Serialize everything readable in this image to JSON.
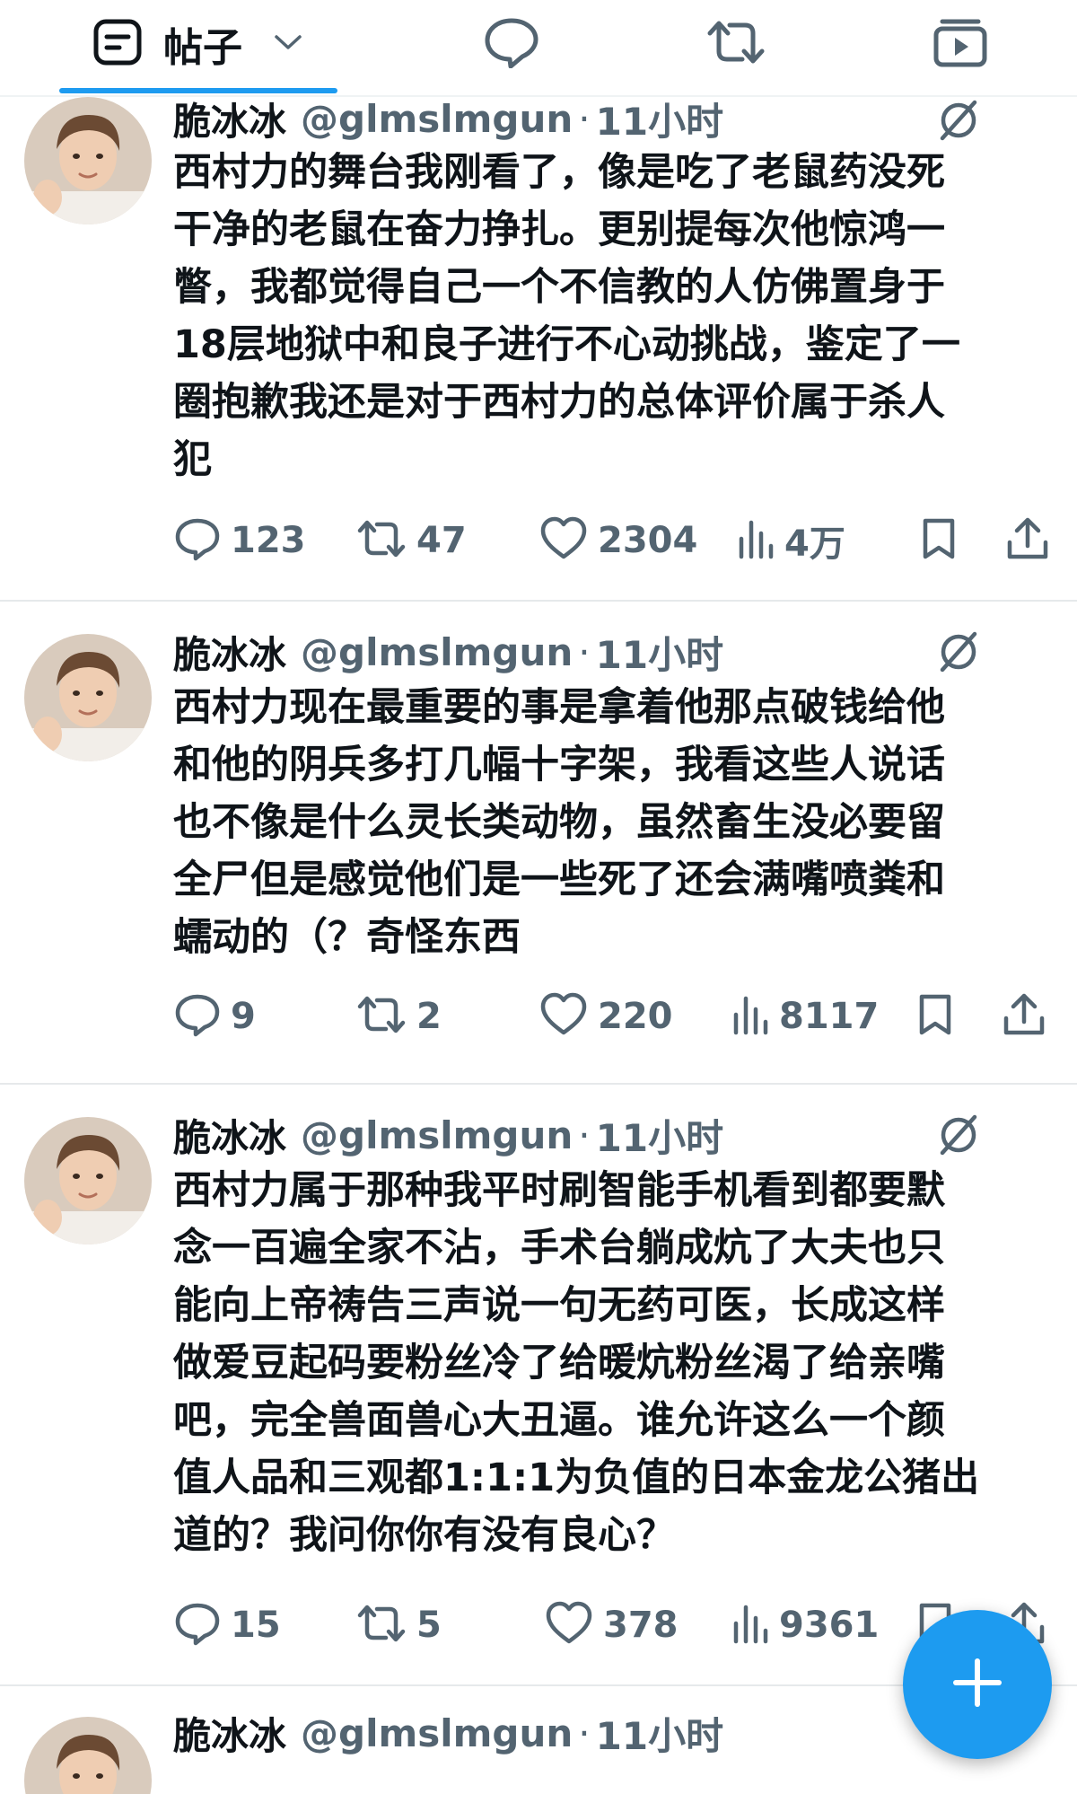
{
  "tabs": {
    "posts_label": "帖子"
  },
  "tweets": [
    {
      "name": "脆冰冰",
      "handle": "@glmslmgun",
      "dot": "·",
      "time": "11小时",
      "text": "西村力的舞台我刚看了，像是吃了老鼠药没死\n干净的老鼠在奋力挣扎。更别提每次他惊鸿一\n瞥，我都觉得自己一个不信教的人仿佛置身于\n18层地狱中和良子进行不心动挑战，鉴定了一\n圈抱歉我还是对于西村力的总体评价属于杀人\n犯",
      "replies": "123",
      "reposts": "47",
      "likes": "2304",
      "views": "4万"
    },
    {
      "name": "脆冰冰",
      "handle": "@glmslmgun",
      "dot": "·",
      "time": "11小时",
      "text": "西村力现在最重要的事是拿着他那点破钱给他\n和他的阴兵多打几幅十字架，我看这些人说话\n也不像是什么灵长类动物，虽然畜生没必要留\n全尸但是感觉他们是一些死了还会满嘴喷粪和\n蠕动的（？奇怪东西",
      "replies": "9",
      "reposts": "2",
      "likes": "220",
      "views": "8117"
    },
    {
      "name": "脆冰冰",
      "handle": "@glmslmgun",
      "dot": "·",
      "time": "11小时",
      "text": "西村力属于那种我平时刷智能手机看到都要默\n念一百遍全家不沾，手术台躺成炕了大夫也只\n能向上帝祷告三声说一句无药可医，长成这样\n做爱豆起码要粉丝冷了给暖炕粉丝渴了给亲嘴\n吧，完全兽面兽心大丑逼。谁允许这么一个颜\n值人品和三观都1:1:1为负值的日本金龙公猪出\n道的？我问你你有没有良心？",
      "replies": "15",
      "reposts": "5",
      "likes": "378",
      "views": "9361"
    },
    {
      "name": "脆冰冰",
      "handle": "@glmslmgun",
      "dot": "·",
      "time": "11小时"
    }
  ],
  "colors": {
    "accent": "#1d9bf0",
    "text_primary": "#0f1419",
    "text_secondary": "#536471"
  },
  "icons": {
    "posts": "posts-icon",
    "chevron": "chevron-down-icon",
    "replies_tab": "speech-bubble-icon",
    "reposts_tab": "repost-icon",
    "media_tab": "video-icon",
    "grok": "grok-icon",
    "reply": "reply-icon",
    "repost": "repost-icon",
    "like": "heart-icon",
    "views": "views-icon",
    "bookmark": "bookmark-icon",
    "share": "share-icon",
    "compose": "plus-icon"
  }
}
